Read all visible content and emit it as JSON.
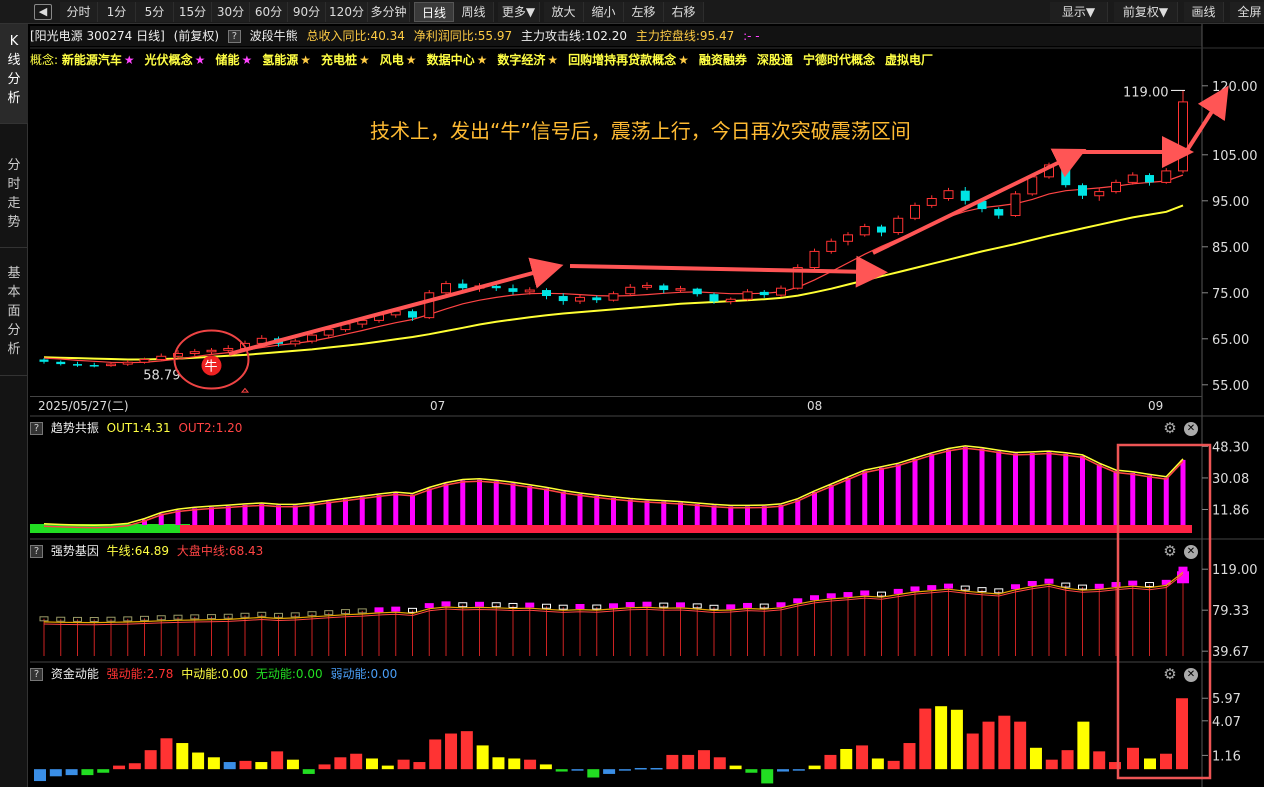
{
  "toolbar": {
    "back_label": "◀",
    "items": [
      "分时",
      "1分",
      "5分",
      "15分",
      "30分",
      "60分",
      "90分",
      "120分",
      "多分钟",
      "日线",
      "周线",
      "更多▼",
      "放大",
      "缩小",
      "左移",
      "右移"
    ],
    "right_items": [
      "显示▼",
      "前复权▼",
      "画线",
      "全屏"
    ]
  },
  "left_tabs": [
    {
      "label": "K线分析"
    },
    {
      "label": "分时走势"
    },
    {
      "label": "基本面分析"
    }
  ],
  "info": {
    "stock": "[阳光电源 300274 日线]",
    "adjust": "(前复权)",
    "indicator": "波段牛熊",
    "revenue": "总收入同比:40.34",
    "profit": "净利润同比:55.97",
    "attack": "主力攻击线:102.20",
    "control": "主力控盘线:95.47",
    "dash": ":-  -"
  },
  "concepts": {
    "prefix": "概念:",
    "items": [
      {
        "name": "新能源汽车",
        "star": "★",
        "star_color": "#ff44ff"
      },
      {
        "name": "光伏概念",
        "star": "★",
        "star_color": "#ff44ff"
      },
      {
        "name": "储能",
        "star": "★",
        "star_color": "#ff44ff"
      },
      {
        "name": "氢能源",
        "star": "★",
        "star_color": "#ffcc44"
      },
      {
        "name": "充电桩",
        "star": "★",
        "star_color": "#ffcc44"
      },
      {
        "name": "风电",
        "star": "★",
        "star_color": "#ffcc44"
      },
      {
        "name": "数据中心",
        "star": "★",
        "star_color": "#ffcc44"
      },
      {
        "name": "数字经济",
        "star": "★",
        "star_color": "#ffcc44"
      },
      {
        "name": "回购增持再贷款概念",
        "star": "★",
        "star_color": "#ffcc44"
      },
      {
        "name": "融资融券",
        "star": "",
        "star_color": ""
      },
      {
        "name": "深股通",
        "star": "",
        "star_color": ""
      },
      {
        "name": "宁德时代概念",
        "star": "",
        "star_color": ""
      },
      {
        "name": "虚拟电厂",
        "star": "",
        "star_color": ""
      }
    ]
  },
  "annotation": "技术上，发出“牛”信号后，震荡上行，今日再次突破震荡区间",
  "bull_signal": "牛",
  "dates": {
    "start": "2025/05/27(二)",
    "m1": "07",
    "m2": "08",
    "m3": "09"
  },
  "panels": {
    "trend": {
      "name": "趋势共振",
      "out1": "OUT1:4.31",
      "out2": "OUT2:1.20"
    },
    "strong": {
      "name": "强势基因",
      "bull": "牛线:64.89",
      "market": "大盘中线:68.43"
    },
    "fund": {
      "name": "资金动能",
      "strong": "强动能:2.78",
      "mid": "中动能:0.00",
      "none": "无动能:0.00",
      "weak": "弱动能:0.00"
    }
  },
  "colors": {
    "up": "#ff3333",
    "down": "#00e5e5",
    "ma_yellow": "#ffff33",
    "ma_red": "#ff4444",
    "magenta": "#ff00ff",
    "green": "#22dd22",
    "yellow": "#ffff00",
    "blue": "#3a8ee6",
    "annotation": "#ffbb33",
    "arrow": "#ff5555"
  },
  "chart_data": {
    "type": "candlestick",
    "ylim": [
      53,
      123
    ],
    "yticks": [
      "120.00",
      "105.00",
      "95.00",
      "85.00",
      "75.00",
      "65.00",
      "55.00"
    ],
    "ytick_values": [
      120,
      105,
      95,
      85,
      75,
      65,
      55
    ],
    "high_label": "119.00",
    "low_label": "58.79",
    "ohlc": [
      [
        60.5,
        60.8,
        59.6,
        60.0
      ],
      [
        60.0,
        60.3,
        59.2,
        59.5
      ],
      [
        59.5,
        60.0,
        58.9,
        59.3
      ],
      [
        59.3,
        59.8,
        58.8,
        59.2
      ],
      [
        59.2,
        59.9,
        58.9,
        59.5
      ],
      [
        59.5,
        60.4,
        59.1,
        59.9
      ],
      [
        59.9,
        60.9,
        59.6,
        60.5
      ],
      [
        60.5,
        61.8,
        60.2,
        61.2
      ],
      [
        61.2,
        62.5,
        60.8,
        61.8
      ],
      [
        61.8,
        62.8,
        61.3,
        62.2
      ],
      [
        62.2,
        63.0,
        61.6,
        62.5
      ],
      [
        62.5,
        63.6,
        62.0,
        62.9
      ],
      [
        62.9,
        64.6,
        62.5,
        64.0
      ],
      [
        64.0,
        65.8,
        63.6,
        65.1
      ],
      [
        65.1,
        65.5,
        63.3,
        63.9
      ],
      [
        63.9,
        65.0,
        63.3,
        64.5
      ],
      [
        64.5,
        66.2,
        64.0,
        65.8
      ],
      [
        65.8,
        67.6,
        65.3,
        67.0
      ],
      [
        67.0,
        68.8,
        66.5,
        68.2
      ],
      [
        68.2,
        69.5,
        67.4,
        69.0
      ],
      [
        69.0,
        70.8,
        68.5,
        70.2
      ],
      [
        70.2,
        71.5,
        69.6,
        71.0
      ],
      [
        71.0,
        71.4,
        68.9,
        69.6
      ],
      [
        69.6,
        75.6,
        69.3,
        75.0
      ],
      [
        75.0,
        77.6,
        74.5,
        77.0
      ],
      [
        77.0,
        77.9,
        75.3,
        76.0
      ],
      [
        76.0,
        77.1,
        75.2,
        76.5
      ],
      [
        76.5,
        77.3,
        75.4,
        76.0
      ],
      [
        76.0,
        76.8,
        74.6,
        75.2
      ],
      [
        75.2,
        76.2,
        74.6,
        75.6
      ],
      [
        75.6,
        76.0,
        73.6,
        74.3
      ],
      [
        74.3,
        74.9,
        72.4,
        73.2
      ],
      [
        73.2,
        74.6,
        72.6,
        74.0
      ],
      [
        74.0,
        74.4,
        72.8,
        73.4
      ],
      [
        73.4,
        75.3,
        73.1,
        74.8
      ],
      [
        74.8,
        76.9,
        74.3,
        76.2
      ],
      [
        76.2,
        77.3,
        75.6,
        76.6
      ],
      [
        76.6,
        77.0,
        74.9,
        75.6
      ],
      [
        75.6,
        76.5,
        75.1,
        75.9
      ],
      [
        75.9,
        76.1,
        74.2,
        74.7
      ],
      [
        74.7,
        75.0,
        72.6,
        73.1
      ],
      [
        73.1,
        74.0,
        72.5,
        73.6
      ],
      [
        73.6,
        75.8,
        73.3,
        75.2
      ],
      [
        75.2,
        75.6,
        73.9,
        74.5
      ],
      [
        74.5,
        76.6,
        74.1,
        76.0
      ],
      [
        76.0,
        81.2,
        75.7,
        80.5
      ],
      [
        80.5,
        84.6,
        80.1,
        84.0
      ],
      [
        84.0,
        86.8,
        83.5,
        86.2
      ],
      [
        86.2,
        88.2,
        85.3,
        87.6
      ],
      [
        87.6,
        90.0,
        87.2,
        89.4
      ],
      [
        89.4,
        89.8,
        87.3,
        88.1
      ],
      [
        88.1,
        91.8,
        87.6,
        91.2
      ],
      [
        91.2,
        94.6,
        90.8,
        94.0
      ],
      [
        94.0,
        96.2,
        93.5,
        95.5
      ],
      [
        95.5,
        97.8,
        95.0,
        97.2
      ],
      [
        97.2,
        98.0,
        94.2,
        95.0
      ],
      [
        95.0,
        95.4,
        92.5,
        93.2
      ],
      [
        93.2,
        93.6,
        91.1,
        91.8
      ],
      [
        91.8,
        97.1,
        91.5,
        96.5
      ],
      [
        96.5,
        100.8,
        96.1,
        100.2
      ],
      [
        100.2,
        103.3,
        99.8,
        102.8
      ],
      [
        102.8,
        103.1,
        97.9,
        98.4
      ],
      [
        98.4,
        98.8,
        95.4,
        96.1
      ],
      [
        96.1,
        97.7,
        95.0,
        97.0
      ],
      [
        97.0,
        99.6,
        96.6,
        99.0
      ],
      [
        99.0,
        101.2,
        98.5,
        100.6
      ],
      [
        100.6,
        101.0,
        98.3,
        99.0
      ],
      [
        99.0,
        102.1,
        98.7,
        101.5
      ],
      [
        101.5,
        119.0,
        101.0,
        116.5
      ]
    ],
    "ma_fast": [
      60.8,
      60.6,
      60.3,
      60.1,
      59.9,
      59.8,
      59.9,
      60.2,
      60.6,
      61.1,
      61.6,
      62.0,
      62.5,
      63.1,
      63.6,
      64.0,
      64.5,
      65.2,
      66.0,
      66.8,
      67.7,
      68.5,
      69.2,
      70.3,
      71.5,
      72.6,
      73.4,
      74.0,
      74.5,
      74.8,
      74.9,
      74.8,
      74.6,
      74.4,
      74.3,
      74.4,
      74.6,
      74.9,
      75.1,
      75.2,
      75.0,
      74.8,
      74.8,
      74.9,
      75.2,
      76.2,
      77.8,
      79.6,
      81.5,
      83.4,
      85.1,
      86.7,
      88.3,
      89.9,
      91.5,
      92.7,
      93.5,
      93.9,
      94.4,
      95.3,
      96.5,
      97.2,
      97.5,
      97.8,
      98.2,
      98.7,
      99.0,
      99.3,
      100.6
    ],
    "ma_slow": [
      61.0,
      60.9,
      60.8,
      60.7,
      60.6,
      60.5,
      60.5,
      60.6,
      60.7,
      60.9,
      61.1,
      61.3,
      61.5,
      61.8,
      62.1,
      62.4,
      62.7,
      63.1,
      63.5,
      63.9,
      64.4,
      64.9,
      65.4,
      66.0,
      66.7,
      67.4,
      68.1,
      68.7,
      69.2,
      69.7,
      70.1,
      70.5,
      70.8,
      71.1,
      71.4,
      71.7,
      72.0,
      72.3,
      72.6,
      72.8,
      73.0,
      73.2,
      73.4,
      73.6,
      73.9,
      74.4,
      75.1,
      75.9,
      76.8,
      77.7,
      78.6,
      79.5,
      80.4,
      81.3,
      82.2,
      83.1,
      84.0,
      84.8,
      85.6,
      86.5,
      87.4,
      88.2,
      89.0,
      89.8,
      90.6,
      91.4,
      92.0,
      92.6,
      94.0
    ],
    "trend_panel": {
      "ylim": [
        0,
        52
      ],
      "yticks": [
        "48.30",
        "30.08",
        "11.86"
      ],
      "ytick_values": [
        48.3,
        30.08,
        11.86
      ],
      "values": [
        3.0,
        2.6,
        2.3,
        2.2,
        2.4,
        3.2,
        6.0,
        9.5,
        11.5,
        12.5,
        13.2,
        13.8,
        14.5,
        15.0,
        14.3,
        14.2,
        15.2,
        16.5,
        17.8,
        19.0,
        20.2,
        21.3,
        20.5,
        24.0,
        26.8,
        28.6,
        29.0,
        28.2,
        27.0,
        25.5,
        24.0,
        22.2,
        20.8,
        19.6,
        18.5,
        17.6,
        16.9,
        16.4,
        15.8,
        15.0,
        14.2,
        13.6,
        13.6,
        13.8,
        14.5,
        17.5,
        22.0,
        26.0,
        30.0,
        34.0,
        36.0,
        38.0,
        41.0,
        44.0,
        46.5,
        48.0,
        47.0,
        45.5,
        44.2,
        44.5,
        45.0,
        44.0,
        42.8,
        38.0,
        34.0,
        33.0,
        31.5,
        30.2,
        40.5
      ]
    },
    "strong_panel": {
      "ylim": [
        35,
        125
      ],
      "yticks": [
        "119.00",
        "79.33",
        "39.67"
      ],
      "ytick_values": [
        119,
        79.33,
        39.67
      ]
    },
    "fund_panel": {
      "ylim": [
        -1.5,
        7.0
      ],
      "yticks": [
        "5.97",
        "4.07",
        "1.16"
      ],
      "ytick_values": [
        5.97,
        4.07,
        1.16
      ],
      "values": [
        -1.0,
        -0.6,
        -0.5,
        -0.5,
        -0.3,
        0.3,
        0.5,
        1.6,
        2.6,
        2.2,
        1.4,
        1.0,
        0.6,
        0.7,
        0.6,
        1.5,
        0.8,
        -0.4,
        0.4,
        1.0,
        1.3,
        0.9,
        0.3,
        0.8,
        0.6,
        2.5,
        3.0,
        3.2,
        2.0,
        1.0,
        0.9,
        0.8,
        0.4,
        -0.2,
        -0.1,
        -0.7,
        -0.4,
        -0.1,
        0.1,
        0.1,
        1.2,
        1.2,
        1.6,
        1.0,
        0.3,
        -0.3,
        -1.2,
        -0.2,
        -0.1,
        0.3,
        1.2,
        1.7,
        2.0,
        0.9,
        0.7,
        2.2,
        5.1,
        5.3,
        5.0,
        3.0,
        4.0,
        4.5,
        4.0,
        1.8,
        0.8,
        1.6,
        4.0,
        1.5,
        0.6
      ],
      "color_codes": [
        "b",
        "b",
        "b",
        "g",
        "g",
        "r",
        "r",
        "r",
        "r",
        "y",
        "y",
        "y",
        "b",
        "r",
        "y",
        "r",
        "y",
        "g",
        "r",
        "r",
        "r",
        "y",
        "y",
        "r",
        "r",
        "r",
        "r",
        "r",
        "y",
        "y",
        "y",
        "r",
        "y",
        "g",
        "b",
        "g",
        "b",
        "b",
        "b",
        "b",
        "r",
        "r",
        "r",
        "r",
        "y",
        "g",
        "g",
        "b",
        "b",
        "y",
        "r",
        "y",
        "r",
        "y",
        "r",
        "r",
        "r",
        "y",
        "y",
        "r",
        "r",
        "r",
        "r",
        "y",
        "r",
        "r",
        "y",
        "r",
        "r"
      ],
      "today_values": [
        1.8,
        0.9,
        1.3,
        5.97
      ],
      "today_codes": [
        "r",
        "y",
        "r",
        "r"
      ]
    }
  }
}
